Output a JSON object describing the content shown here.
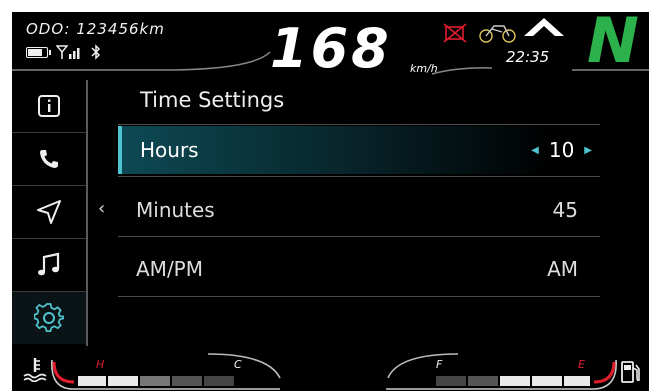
{
  "header": {
    "odo": "ODO: 123456km",
    "speed": "168",
    "speed_unit": "km/h",
    "time": "22:35",
    "gear": "N",
    "gear_color": "#2bb24c"
  },
  "sidebar": {
    "items": [
      {
        "icon": "info-icon"
      },
      {
        "icon": "phone-icon"
      },
      {
        "icon": "navigation-icon"
      },
      {
        "icon": "music-icon"
      },
      {
        "icon": "settings-icon",
        "active": true
      }
    ]
  },
  "main": {
    "title": "Time Settings",
    "rows": [
      {
        "label": "Hours",
        "value": "10",
        "selected": true
      },
      {
        "label": "Minutes",
        "value": "45"
      },
      {
        "label": "AM/PM",
        "value": "AM"
      }
    ]
  },
  "gauges": {
    "temp_high": "H",
    "temp_low": "C",
    "fuel_low": "F",
    "fuel_empty": "E",
    "accent_color": "#e11d2e"
  }
}
